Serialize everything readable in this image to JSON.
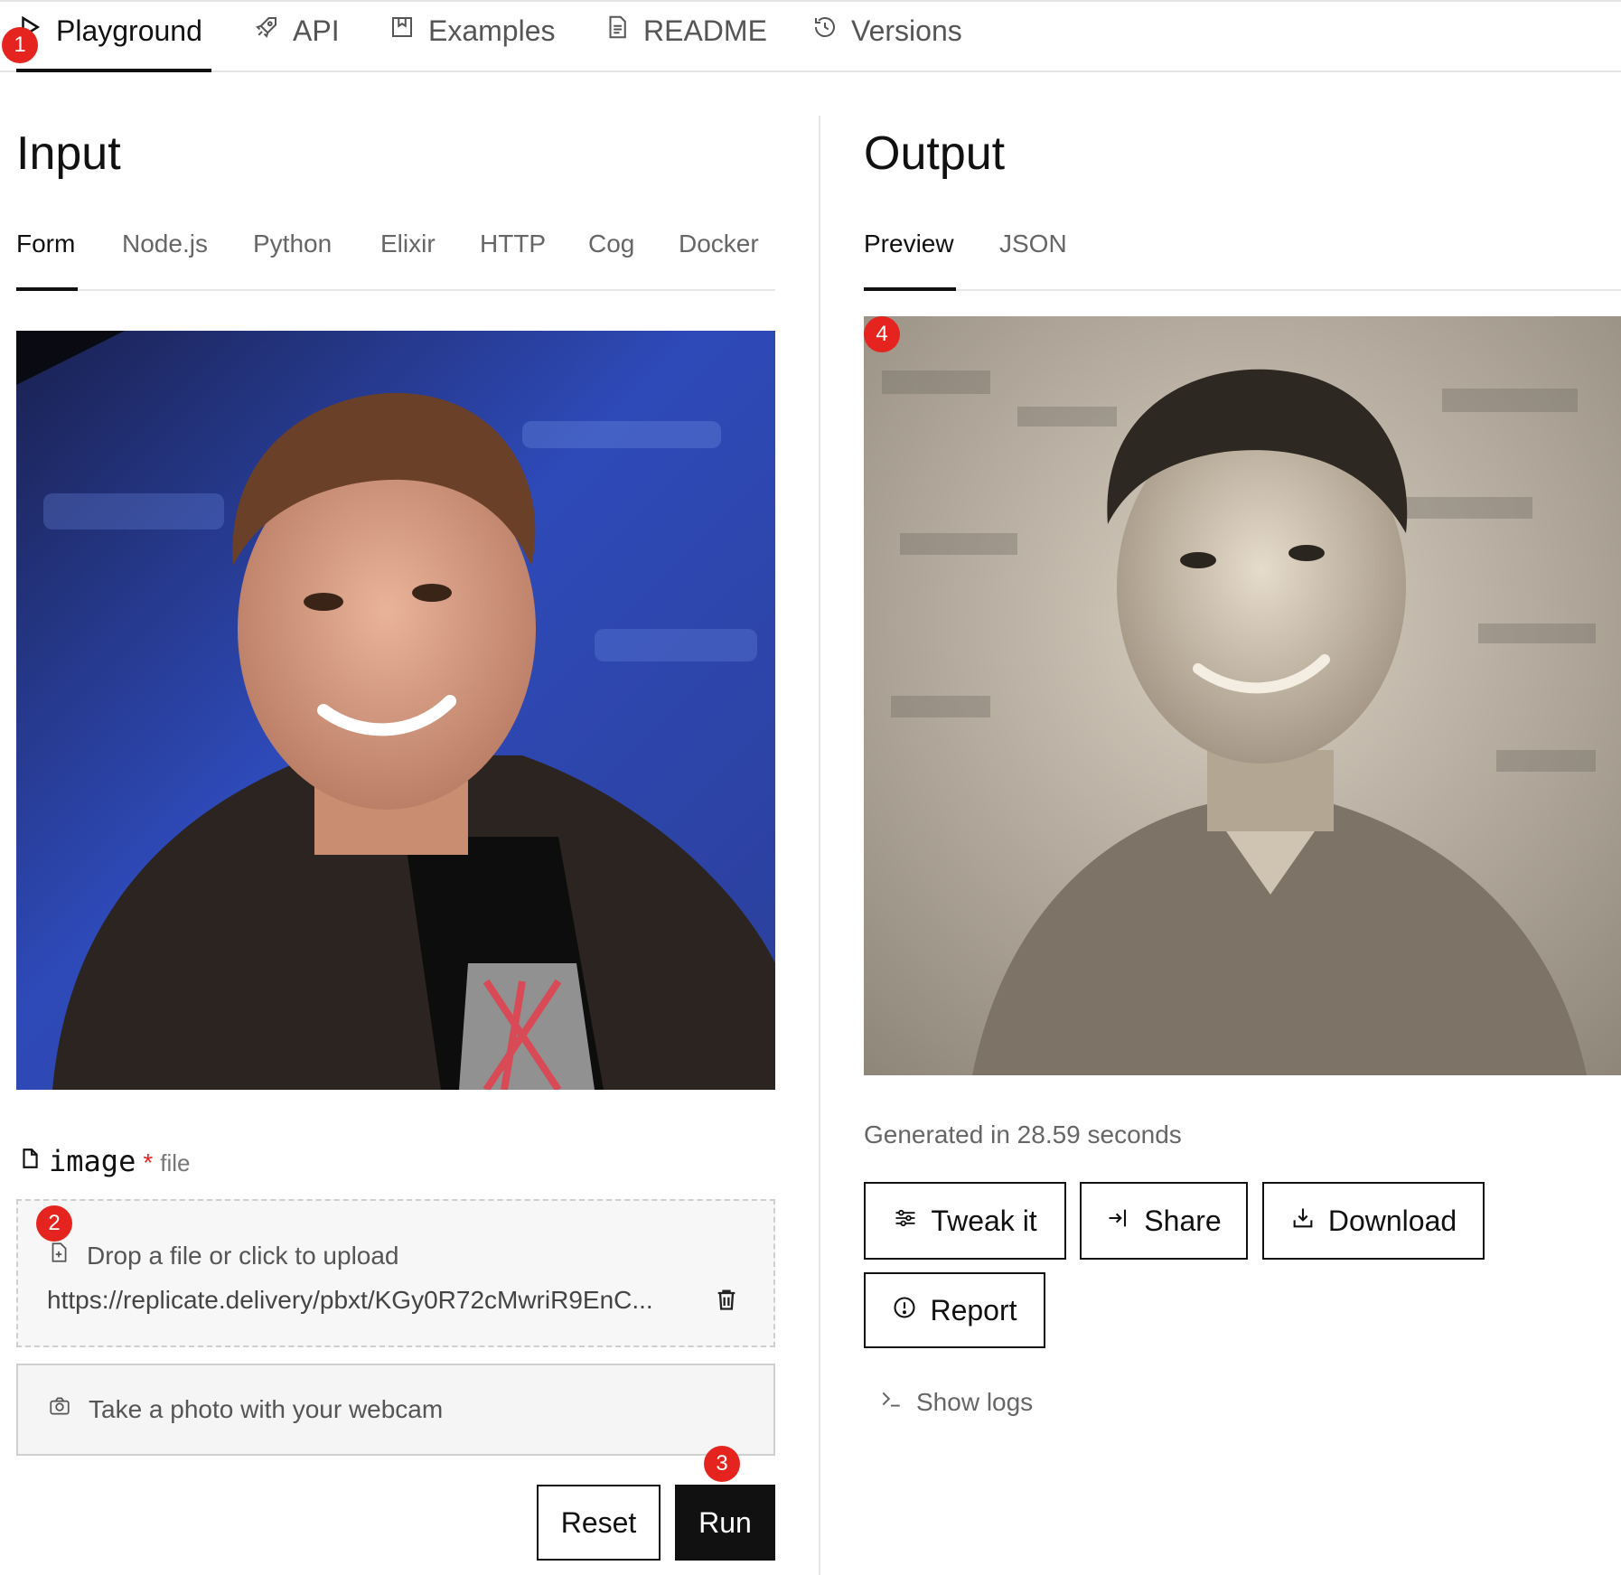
{
  "nav": {
    "tabs": [
      {
        "label": "Playground",
        "icon": "play-icon"
      },
      {
        "label": "API",
        "icon": "rocket-icon"
      },
      {
        "label": "Examples",
        "icon": "bookmark-icon"
      },
      {
        "label": "README",
        "icon": "document-icon"
      },
      {
        "label": "Versions",
        "icon": "history-icon"
      }
    ],
    "active": "Playground"
  },
  "badges": [
    "1",
    "2",
    "3",
    "4"
  ],
  "input": {
    "title": "Input",
    "tabs": [
      "Form",
      "Node.js",
      "Python",
      "Elixir",
      "HTTP",
      "Cog",
      "Docker"
    ],
    "active_tab": "Form",
    "field": {
      "name": "image",
      "required_mark": "*",
      "type": "file",
      "dropzone_text": "Drop a file or click to upload",
      "value_url": "https://replicate.delivery/pbxt/KGy0R72cMwriR9EnC...",
      "webcam_text": "Take a photo with your webcam"
    },
    "buttons": {
      "reset": "Reset",
      "run": "Run"
    }
  },
  "output": {
    "title": "Output",
    "tabs": [
      "Preview",
      "JSON"
    ],
    "active_tab": "Preview",
    "generated_text": "Generated in 28.59 seconds",
    "buttons": {
      "tweak": "Tweak it",
      "share": "Share",
      "download": "Download",
      "report": "Report"
    },
    "logs_label": "Show logs"
  },
  "colors": {
    "accent": "#111111",
    "badge": "#e52420",
    "border": "#e4e4e4"
  }
}
